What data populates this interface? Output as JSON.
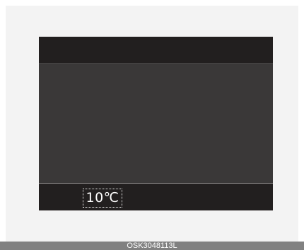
{
  "display": {
    "temperature": "10℃"
  },
  "caption": {
    "code": "OSK3048113L"
  }
}
